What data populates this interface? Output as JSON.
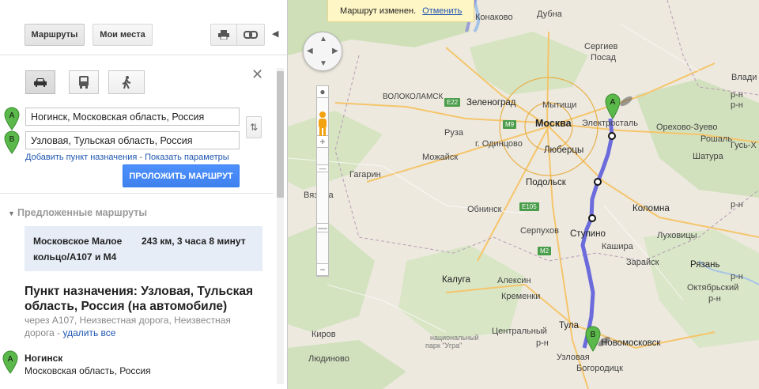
{
  "topbar": {
    "routes_label": "Маршруты",
    "places_label": "Мои места",
    "print_icon": "printer-icon",
    "link_icon": "link-icon",
    "collapse_icon": "chevron-left-icon"
  },
  "directions": {
    "modes": [
      "car-icon",
      "bus-icon",
      "walk-icon"
    ],
    "close_icon": "close-icon",
    "from_marker": "A",
    "to_marker": "B",
    "from_value": "Ногинск, Московская область, Россия",
    "to_value": "Узловая, Тульская область, Россия",
    "swap_icon": "swap-icon",
    "add_destination": "Добавить пункт назначения",
    "separator": "-",
    "show_options": "Показать параметры",
    "route_button": "ПРОЛОЖИТЬ МАРШРУТ"
  },
  "suggested": {
    "heading": "Предложенные маршруты",
    "route_name": "Московское Малое кольцо/A107 и M4",
    "route_info": "243 км, 3 часа 8 минут"
  },
  "destination": {
    "title": "Пункт назначения: Узловая, Тульская область, Россия (на автомобиле)",
    "via_text": "через A107, Неизвестная дорога, Неизвестная дорога -",
    "remove_all": "удалить все"
  },
  "step": {
    "marker": "A",
    "title": "Ногинск",
    "subtitle": "Московская область, Россия"
  },
  "map": {
    "toast_text": "Маршрут изменен.",
    "toast_undo": "Отменить",
    "route_color": "#6b6bdc",
    "marker_color": "#5bb84a",
    "labels": {
      "konakovo": "Конаково",
      "dubna": "Дубна",
      "sergiev": "Сергиев",
      "posad": "Посад",
      "vladimir": "Влади",
      "volokolamsk": "ВОЛОКОЛАМСК",
      "zelenograd": "Зеленоград",
      "mytishchi": "Мытищи",
      "elektrostal": "Электросталь",
      "moscow": "Москва",
      "orekhovo": "Орехово-Зуево",
      "ruza": "Руза",
      "odintsovo": "г. Одинцово",
      "lyubertsy": "Люберцы",
      "roshal": "Рошаль",
      "gus": "Гусь-Х",
      "mozhaysk": "Можайск",
      "shatura": "Шатура",
      "gagarin": "Гагарин",
      "podolsk": "Подольск",
      "vyazma": "Вязьма",
      "obninsk": "Обнинск",
      "kolomna": "Коломна",
      "serpukhov": "Серпухов",
      "stupino": "Ступино",
      "lukhovitsy": "Луховицы",
      "kashira": "Кашира",
      "zaraysk": "Зарайск",
      "ryazan": "Рязань",
      "kaluga": "Калуга",
      "aleksin": "Алексин",
      "oktyabrsky": "Октябрьский",
      "kremenki": "Кременки",
      "rn": "р-н",
      "tula": "Тула",
      "kirov": "Киров",
      "central_rn": "Центральный",
      "nat_park": "национальный",
      "nat_park2": "парк \"Угра\"",
      "novomoskovsk": "Новомосковск",
      "lyudinovo": "Людиново",
      "uzlovaya": "Узловая",
      "bogoroditsk": "Богородицк"
    },
    "shields": {
      "e22": "E22",
      "m9": "M9",
      "e105": "E105",
      "m2": "M2"
    }
  }
}
